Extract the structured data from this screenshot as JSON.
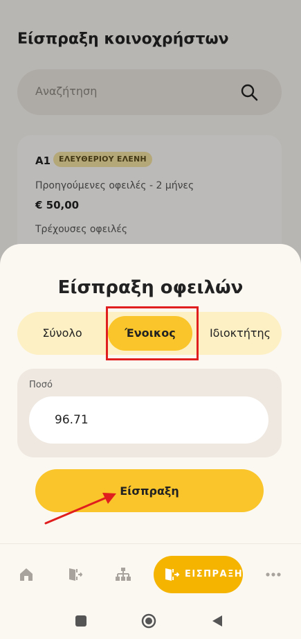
{
  "page": {
    "title": "Είσπραξη κοινοχρήστων",
    "search_placeholder": "Αναζήτηση",
    "card": {
      "unit": "Α1",
      "owner_name": "ΕΛΕΥΘΕΡΙΟΥ ΕΛΕΝΗ",
      "previous_label": "Προηγούμενες οφειλές - 2 μήνες",
      "previous_amount": "€ 50,00",
      "current_label": "Τρέχουσες οφειλές"
    }
  },
  "sheet": {
    "title": "Είσπραξη οφειλών",
    "segments": {
      "total": "Σύνολο",
      "tenant": "Ένοικος",
      "owner": "Ιδιοκτήτης",
      "selected": "tenant"
    },
    "amount_label": "Ποσό",
    "amount_value": "96.71",
    "collect_button": "Είσπραξη"
  },
  "bottom_nav": {
    "items": [
      "home-icon",
      "door-exit-icon",
      "hierarchy-icon"
    ],
    "cta_label": "ΕΙΣΠΡΑΞΗ",
    "more": "more-icon"
  },
  "colors": {
    "accent": "#f9c52a",
    "cta": "#f4b400",
    "highlight": "#e01e1e"
  }
}
